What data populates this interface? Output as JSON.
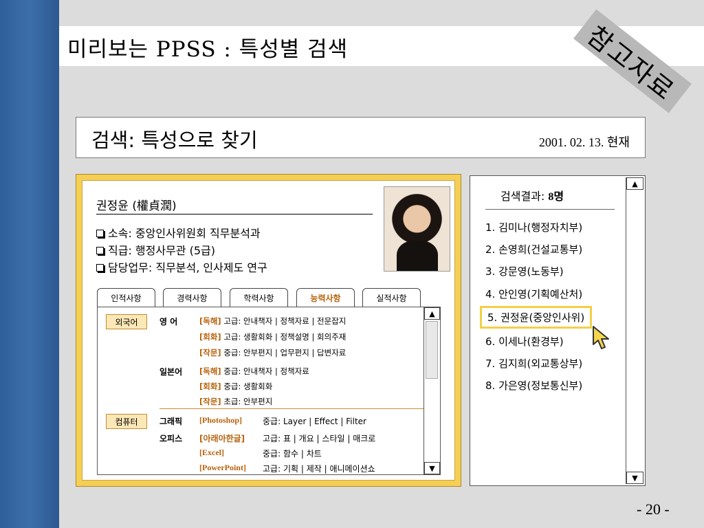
{
  "slide": {
    "title": "미리보는 PPSS : 특성별 검색",
    "badge": "참고자료",
    "page_number": "- 20 -"
  },
  "header": {
    "title": "검색: 특성으로 찾기",
    "date": "2001. 02. 13. 현재"
  },
  "profile": {
    "name": "권정윤 (權貞潤)",
    "info": [
      "소속: 중앙인사위원회 직무분석과",
      "직급: 행정사무관 (5급)",
      "담당업무: 직무분석, 인사제도 연구"
    ],
    "tabs": [
      "인적사항",
      "경력사항",
      "학력사항",
      "능력사항",
      "실적사항"
    ],
    "active_tab": "능력사항",
    "foreign_language": {
      "category": "외국어",
      "entries": [
        {
          "lang": "영  어",
          "lines": [
            {
              "tag": "[독해]",
              "text": "고급: 안내책자 | 정책자료 | 전문잡지"
            },
            {
              "tag": "[회화]",
              "text": "고급: 생활회화 | 정책설명 | 회의주재"
            },
            {
              "tag": "[작문]",
              "text": "중급: 안부편지 | 업무편지 | 답변자료"
            }
          ]
        },
        {
          "lang": "일본어",
          "lines": [
            {
              "tag": "[독해]",
              "text": "중급: 안내책자 | 정책자료"
            },
            {
              "tag": "[회화]",
              "text": "중급: 생활회화"
            },
            {
              "tag": "[작문]",
              "text": "초급: 안부편지"
            }
          ]
        }
      ]
    },
    "computer": {
      "category": "컴퓨터",
      "entries": [
        {
          "group": "그래픽",
          "tag": "[Photoshop]",
          "text": "중급: Layer | Effect | Filter"
        },
        {
          "group": "오피스",
          "tag": "[아래아한글]",
          "text": "고급: 표 | 개요 | 스타일 | 매크로"
        },
        {
          "group": "",
          "tag": "[Excel]",
          "text": "중급: 함수 | 차트"
        },
        {
          "group": "",
          "tag": "[PowerPoint]",
          "text": "고급: 기획 | 제작 | 애니메이션쇼"
        }
      ]
    }
  },
  "results": {
    "title_prefix": "검색결과: ",
    "count": "8명",
    "selected_index": 4,
    "items": [
      "1. 김미나(행정자치부)",
      "2. 손영희(건설교통부)",
      "3. 강문영(노동부)",
      "4. 안인영(기획예산처)",
      "5. 권정윤(중앙인사위)",
      "6. 이세나(환경부)",
      "7. 김지희(외교통상부)",
      "8. 가은영(정보통신부)"
    ]
  },
  "icons": {
    "scroll_up": "▲",
    "scroll_down": "▼",
    "cursor": "arrow-cursor-icon"
  }
}
